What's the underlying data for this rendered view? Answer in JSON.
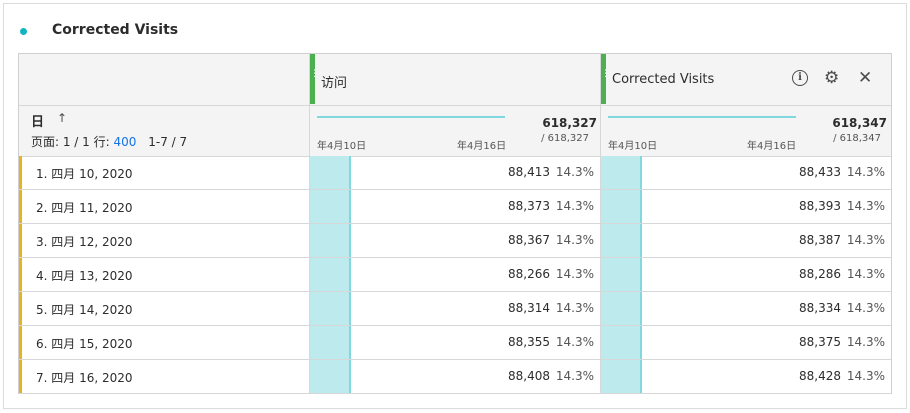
{
  "panel": {
    "title": "Corrected Visits",
    "accent_color": "#13b5c2"
  },
  "table": {
    "dimension": {
      "name": "日",
      "sort_icon": "arrow-up-icon"
    },
    "paging": {
      "page_text": "页面: 1 / 1 行:",
      "rows_per_page": "400",
      "range": "1-7 / 7"
    },
    "columns": [
      {
        "name": "访问",
        "total": "618,327",
        "total_of": "/ 618,327",
        "spark_start": "年4月10日",
        "spark_end": "年4月16日",
        "bar_fraction": 0.143
      },
      {
        "name": "Corrected Visits",
        "total": "618,347",
        "total_of": "/ 618,347",
        "spark_start": "年4月10日",
        "spark_end": "年4月16日",
        "bar_fraction": 0.143,
        "icons": [
          "info-icon",
          "gear-icon",
          "close-icon"
        ]
      }
    ],
    "rows": [
      {
        "label": "1. 四月 10, 2020",
        "c1": "88,413",
        "p1": "14.3%",
        "c2": "88,433",
        "p2": "14.3%"
      },
      {
        "label": "2. 四月 11, 2020",
        "c1": "88,373",
        "p1": "14.3%",
        "c2": "88,393",
        "p2": "14.3%"
      },
      {
        "label": "3. 四月 12, 2020",
        "c1": "88,367",
        "p1": "14.3%",
        "c2": "88,387",
        "p2": "14.3%"
      },
      {
        "label": "4. 四月 13, 2020",
        "c1": "88,266",
        "p1": "14.3%",
        "c2": "88,286",
        "p2": "14.3%"
      },
      {
        "label": "5. 四月 14, 2020",
        "c1": "88,314",
        "p1": "14.3%",
        "c2": "88,334",
        "p2": "14.3%"
      },
      {
        "label": "6. 四月 15, 2020",
        "c1": "88,355",
        "p1": "14.3%",
        "c2": "88,375",
        "p2": "14.3%"
      },
      {
        "label": "7. 四月 16, 2020",
        "c1": "88,408",
        "p1": "14.3%",
        "c2": "88,428",
        "p2": "14.3%"
      }
    ],
    "colors": {
      "column_marker": "#4caf50",
      "row_accent": "#e6b421",
      "bar_fill": "#bdeaed",
      "link": "#1473e6"
    }
  }
}
